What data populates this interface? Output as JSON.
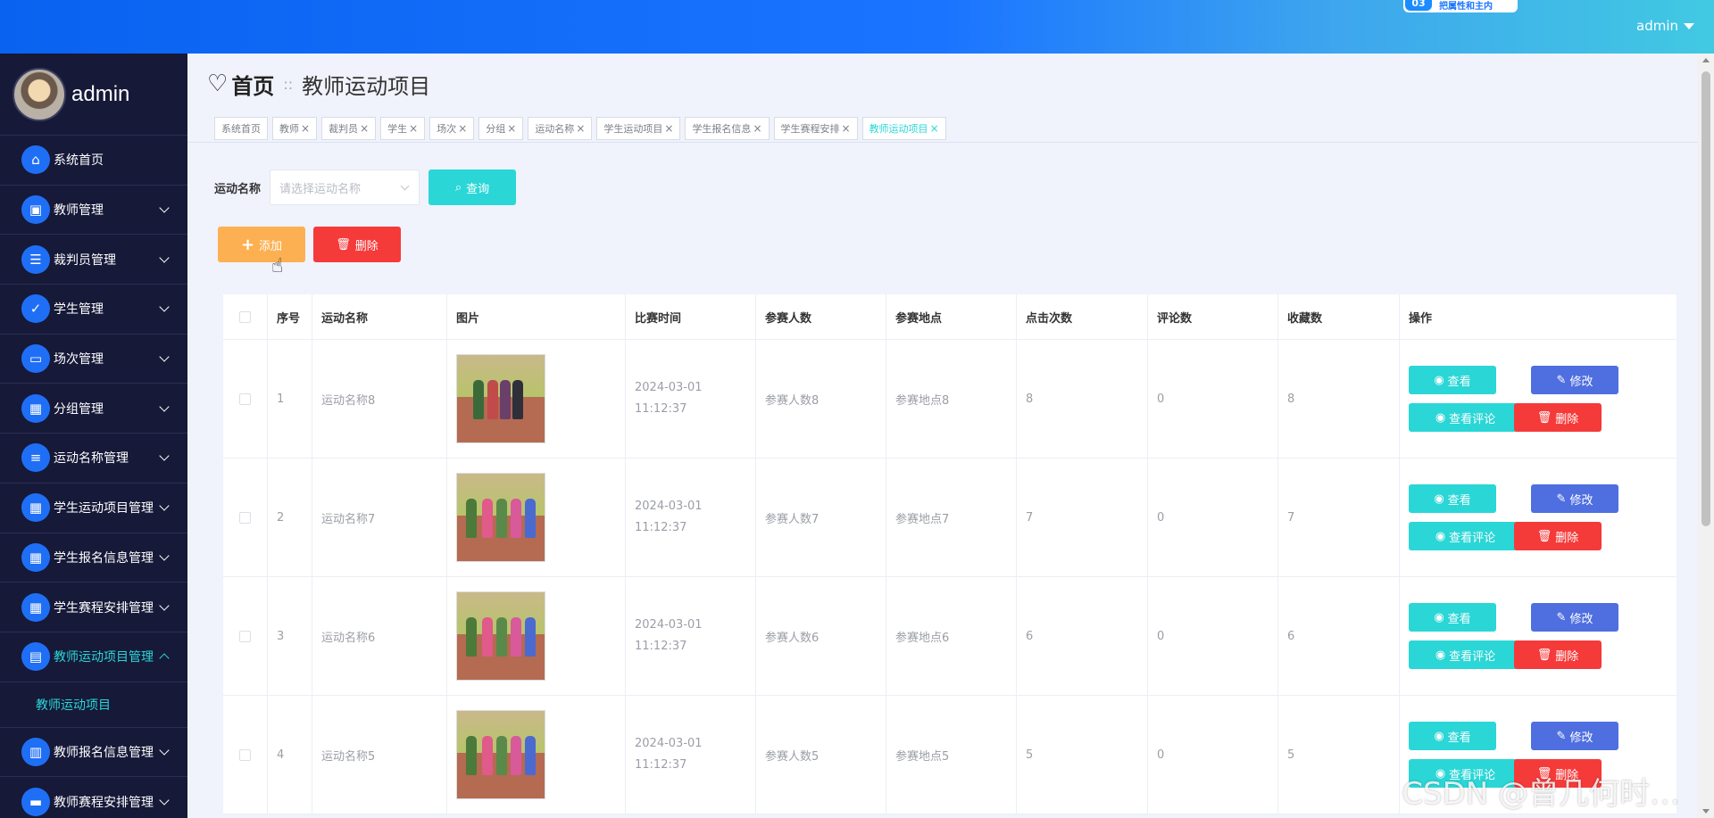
{
  "topbar": {
    "badge_icon": "03",
    "badge_text": "把属性和主内",
    "user": "admin"
  },
  "sidebar": {
    "profile_name": "admin",
    "items": [
      {
        "label": "系统首页",
        "icon": "home-icon",
        "glyph": "⌂",
        "expandable": false
      },
      {
        "label": "教师管理",
        "icon": "briefcase-icon",
        "glyph": "▣",
        "expandable": true
      },
      {
        "label": "裁判员管理",
        "icon": "sliders-icon",
        "glyph": "☰",
        "expandable": true
      },
      {
        "label": "学生管理",
        "icon": "thumbs-up-icon",
        "glyph": "✓",
        "expandable": true
      },
      {
        "label": "场次管理",
        "icon": "monitor-icon",
        "glyph": "▭",
        "expandable": true
      },
      {
        "label": "分组管理",
        "icon": "grid-icon",
        "glyph": "▦",
        "expandable": true
      },
      {
        "label": "运动名称管理",
        "icon": "list-icon",
        "glyph": "≡",
        "expandable": true
      },
      {
        "label": "学生运动项目管理",
        "icon": "grid-icon",
        "glyph": "▦",
        "expandable": true
      },
      {
        "label": "学生报名信息管理",
        "icon": "grid-icon",
        "glyph": "▦",
        "expandable": true
      },
      {
        "label": "学生赛程安排管理",
        "icon": "grid-icon",
        "glyph": "▦",
        "expandable": true
      },
      {
        "label": "教师运动项目管理",
        "icon": "clipboard-icon",
        "glyph": "▤",
        "expandable": true,
        "active": true
      },
      {
        "label": "教师报名信息管理",
        "icon": "book-icon",
        "glyph": "▥",
        "expandable": true
      },
      {
        "label": "教师赛程安排管理",
        "icon": "ticket-icon",
        "glyph": "▬",
        "expandable": true
      }
    ],
    "submenu_label": "教师运动项目"
  },
  "header": {
    "home": "首页",
    "separator": "::",
    "current": "教师运动项目"
  },
  "tags": [
    {
      "label": "系统首页",
      "closable": false
    },
    {
      "label": "教师",
      "closable": true
    },
    {
      "label": "裁判员",
      "closable": true
    },
    {
      "label": "学生",
      "closable": true
    },
    {
      "label": "场次",
      "closable": true
    },
    {
      "label": "分组",
      "closable": true
    },
    {
      "label": "运动名称",
      "closable": true
    },
    {
      "label": "学生运动项目",
      "closable": true
    },
    {
      "label": "学生报名信息",
      "closable": true
    },
    {
      "label": "学生赛程安排",
      "closable": true
    },
    {
      "label": "教师运动项目",
      "closable": true,
      "active": true
    }
  ],
  "search": {
    "label": "运动名称",
    "placeholder": "请选择运动名称",
    "query_label": "查询"
  },
  "actions": {
    "add_label": "添加",
    "delete_label": "删除"
  },
  "table": {
    "columns": [
      "序号",
      "运动名称",
      "图片",
      "比赛时间",
      "参赛人数",
      "参赛地点",
      "点击次数",
      "评论数",
      "收藏数",
      "操作"
    ],
    "rows": [
      {
        "index": "1",
        "name": "运动名称8",
        "time": "2024-03-01 11:12:37",
        "count": "参赛人数8",
        "place": "参赛地点8",
        "clicks": "8",
        "comments": "0",
        "favorites": "8"
      },
      {
        "index": "2",
        "name": "运动名称7",
        "time": "2024-03-01 11:12:37",
        "count": "参赛人数7",
        "place": "参赛地点7",
        "clicks": "7",
        "comments": "0",
        "favorites": "7"
      },
      {
        "index": "3",
        "name": "运动名称6",
        "time": "2024-03-01 11:12:37",
        "count": "参赛人数6",
        "place": "参赛地点6",
        "clicks": "6",
        "comments": "0",
        "favorites": "6"
      },
      {
        "index": "4",
        "name": "运动名称5",
        "time": "2024-03-01 11:12:37",
        "count": "参赛人数5",
        "place": "参赛地点5",
        "clicks": "5",
        "comments": "0",
        "favorites": "5"
      }
    ],
    "row_actions": {
      "view": "查看",
      "edit": "修改",
      "comments": "查看评论",
      "delete": "删除"
    }
  },
  "watermark": "CSDN @曾几何时…",
  "colors": {
    "primary": "#1a74ff",
    "sidebar_bg": "#161938",
    "accent_teal": "#2bd6d6",
    "add_orange": "#fdb051",
    "delete_red": "#f53a3a",
    "edit_blue": "#4f6fe0"
  }
}
